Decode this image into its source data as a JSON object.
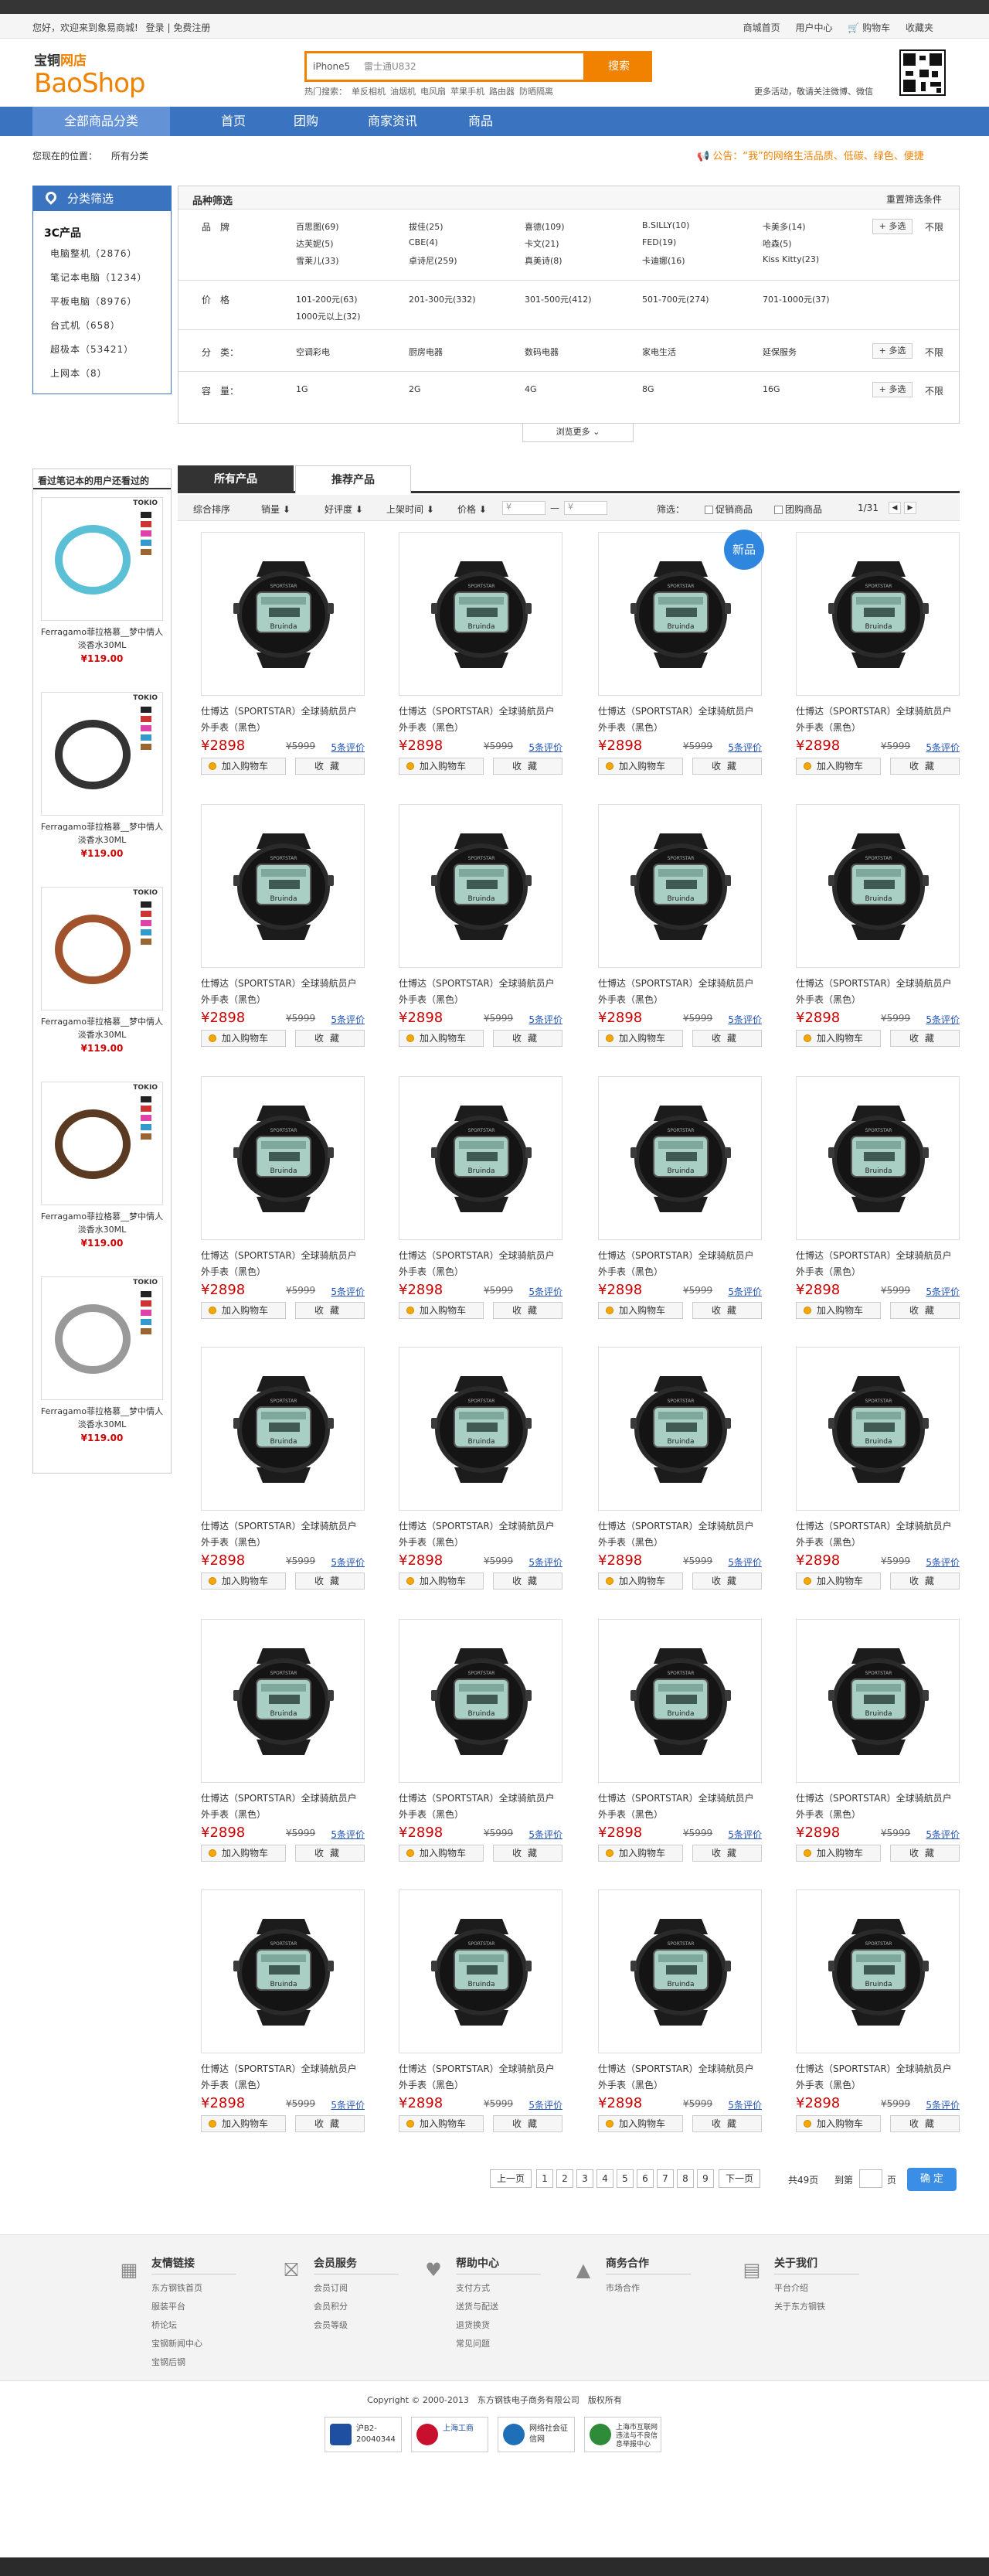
{
  "topbar": {
    "welcome": "您好，欢迎来到象易商城!",
    "login": "登录",
    "register": "免费注册",
    "links": [
      "商城首页",
      "用户中心",
      "购物车",
      "收藏夹"
    ]
  },
  "logo": {
    "cn_black": "宝铜",
    "cn_orange": "网店",
    "en": "BaoShop"
  },
  "search": {
    "value": "iPhone5",
    "hint": "雷士通U832",
    "button": "搜索",
    "hot_label": "热门搜索：",
    "hot_words": [
      "单反相机",
      "油烟机",
      "电风扇",
      "苹果手机",
      "路由器",
      "防晒隔离"
    ]
  },
  "qr_note": "更多活动，敬请关注微博、微信",
  "nav": {
    "all": "全部商品分类",
    "items": [
      "首页",
      "团购",
      "商家资讯",
      "商品"
    ]
  },
  "crumb": {
    "label": "您现在的位置：",
    "value": "所有分类"
  },
  "notice": "公告：“我”的网络生活品质、低碳、绿色、便捷",
  "side": {
    "title": "分类筛选",
    "category": "3C产品",
    "items": [
      "电脑整机（2876）",
      "笔记本电脑（1234）",
      "平板电脑（8976）",
      "台式机（658）",
      "超极本（53421）",
      "上网本（8）"
    ]
  },
  "filter": {
    "title": "品种筛选",
    "reset": "重置筛选条件",
    "multi": "+ 多选",
    "nolimit": "不限",
    "more": "浏览更多",
    "brand_label": "品　牌",
    "brands": [
      "百思图(69)",
      "达芙妮(5)",
      "雪莱儿(33)",
      "拔佳(25)",
      "CBE(4)",
      "卓诗尼(259)",
      "喜德(109)",
      "卡文(21)",
      "真美诗(8)",
      "B.SILLY(10)",
      "FED(19)",
      "卡迪娜(16)",
      "卡美多(14)",
      "哈森(5)",
      "Kiss Kitty(23)"
    ],
    "price_label": "价　格",
    "prices": [
      "101-200元(63)",
      "1000元以上(32)",
      "201-300元(332)",
      "301-500元(412)",
      "501-700元(274)",
      "701-1000元(37)"
    ],
    "cat_label": "分　类：",
    "cats": [
      "空调彩电",
      "厨房电器",
      "数码电器",
      "家电生活",
      "延保服务"
    ],
    "cap_label": "容　量：",
    "caps": [
      "1G",
      "2G",
      "4G",
      "8G",
      "16G"
    ]
  },
  "also": {
    "title": "看过笔记本的用户还看过的",
    "items": [
      {
        "name": "Ferragamo菲拉格慕__梦中情人淡香水30ML",
        "price": "¥119.00"
      },
      {
        "name": "Ferragamo菲拉格慕__梦中情人淡香水30ML",
        "price": "¥119.00"
      },
      {
        "name": "Ferragamo菲拉格慕__梦中情人淡香水30ML",
        "price": "¥119.00"
      },
      {
        "name": "Ferragamo菲拉格慕__梦中情人淡香水30ML",
        "price": "¥119.00"
      },
      {
        "name": "Ferragamo菲拉格慕__梦中情人淡香水30ML",
        "price": "¥119.00"
      }
    ],
    "brand_tag": "TOKIO"
  },
  "tabs": [
    "所有产品",
    "推荐产品"
  ],
  "sort": {
    "labels": [
      "综合排序",
      "销量 ⬇",
      "好评度 ⬇",
      "上架时间 ⬇",
      "价格 ⬇"
    ],
    "price_from": "¥",
    "price_to": "¥",
    "filter_label": "筛选：",
    "promo": "促销商品",
    "group": "团购商品",
    "page": "1/31"
  },
  "product": {
    "title": "仕博达（SPORTSTAR）全球骑航员户外手表（黑色）",
    "price": "¥2898",
    "old_price": "¥5999",
    "reviews": "5条评价",
    "buy": "加入购物车",
    "fav": "收藏",
    "new_badge": "新品",
    "watch_text": "Bruinda"
  },
  "pager": {
    "prev": "上一页",
    "pages": [
      "1",
      "2",
      "3",
      "4",
      "5",
      "6",
      "7",
      "8",
      "9"
    ],
    "next": "下一页",
    "total": "共49页",
    "goto": "到第",
    "page_unit": "页",
    "confirm": "确 定"
  },
  "footer": {
    "cols": [
      {
        "title": "友情链接",
        "icon": "link-icon",
        "links": [
          "东方钢铁首页",
          "服装平台",
          "桥论坛",
          "宝钢新闻中心",
          "宝钢后钢"
        ]
      },
      {
        "title": "会员服务",
        "icon": "gift-icon",
        "links": [
          "会员订阅",
          "会员积分",
          "会员等级"
        ]
      },
      {
        "title": "帮助中心",
        "icon": "heart-icon",
        "links": [
          "支付方式",
          "送货与配送",
          "退货换货",
          "常见问题"
        ]
      },
      {
        "title": "商务合作",
        "icon": "hat-icon",
        "links": [
          "市场合作"
        ]
      },
      {
        "title": "关于我们",
        "icon": "info-icon",
        "links": [
          "平台介绍",
          "关于东方钢铁"
        ]
      }
    ],
    "copyright": "Copyright © 2000-2013　东方钢铁电子商务有限公司　版权所有",
    "badges": [
      "沪B2-20040344",
      "上海工商",
      "网络社会征信网",
      "上海市互联网违法与不良信息举报中心"
    ]
  }
}
